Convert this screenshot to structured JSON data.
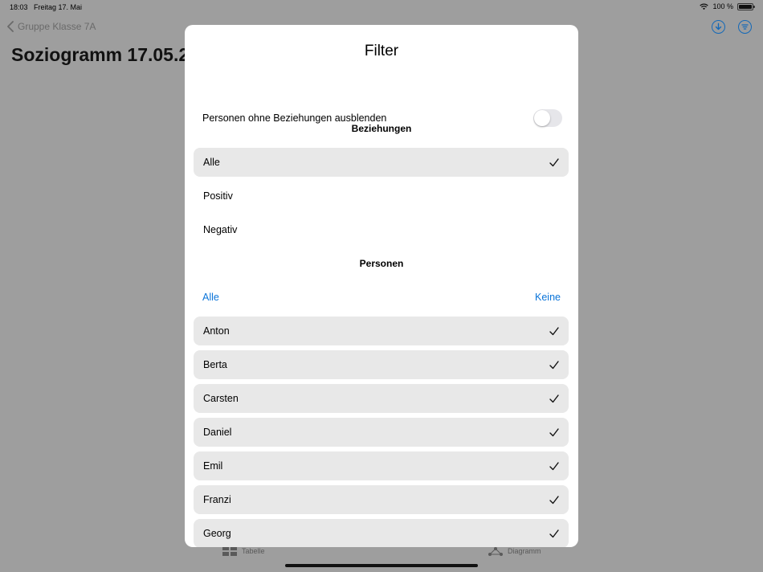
{
  "status_bar": {
    "time": "18:03",
    "date": "Freitag 17. Mai",
    "battery": "100 %"
  },
  "nav": {
    "back_label": "Gruppe Klasse 7A",
    "page_title": "Soziogramm 17.05.2"
  },
  "tabs": [
    {
      "label": "Tabelle"
    },
    {
      "label": "Diagramm"
    }
  ],
  "colors": {
    "accent": "#0a74d9",
    "selected_row": "#e8e8e8"
  },
  "filter": {
    "title": "Filter",
    "hide_unrelated_label": "Personen ohne Beziehungen ausblenden",
    "hide_unrelated_on": false,
    "relations_header": "Beziehungen",
    "relations": [
      {
        "label": "Alle",
        "checked": true
      },
      {
        "label": "Positiv",
        "checked": false
      },
      {
        "label": "Negativ",
        "checked": false
      }
    ],
    "persons_header": "Personen",
    "select_all_label": "Alle",
    "select_none_label": "Keine",
    "persons": [
      {
        "label": "Anton",
        "checked": true
      },
      {
        "label": "Berta",
        "checked": true
      },
      {
        "label": "Carsten",
        "checked": true
      },
      {
        "label": "Daniel",
        "checked": true
      },
      {
        "label": "Emil",
        "checked": true
      },
      {
        "label": "Franzi",
        "checked": true
      },
      {
        "label": "Georg",
        "checked": true
      }
    ]
  }
}
